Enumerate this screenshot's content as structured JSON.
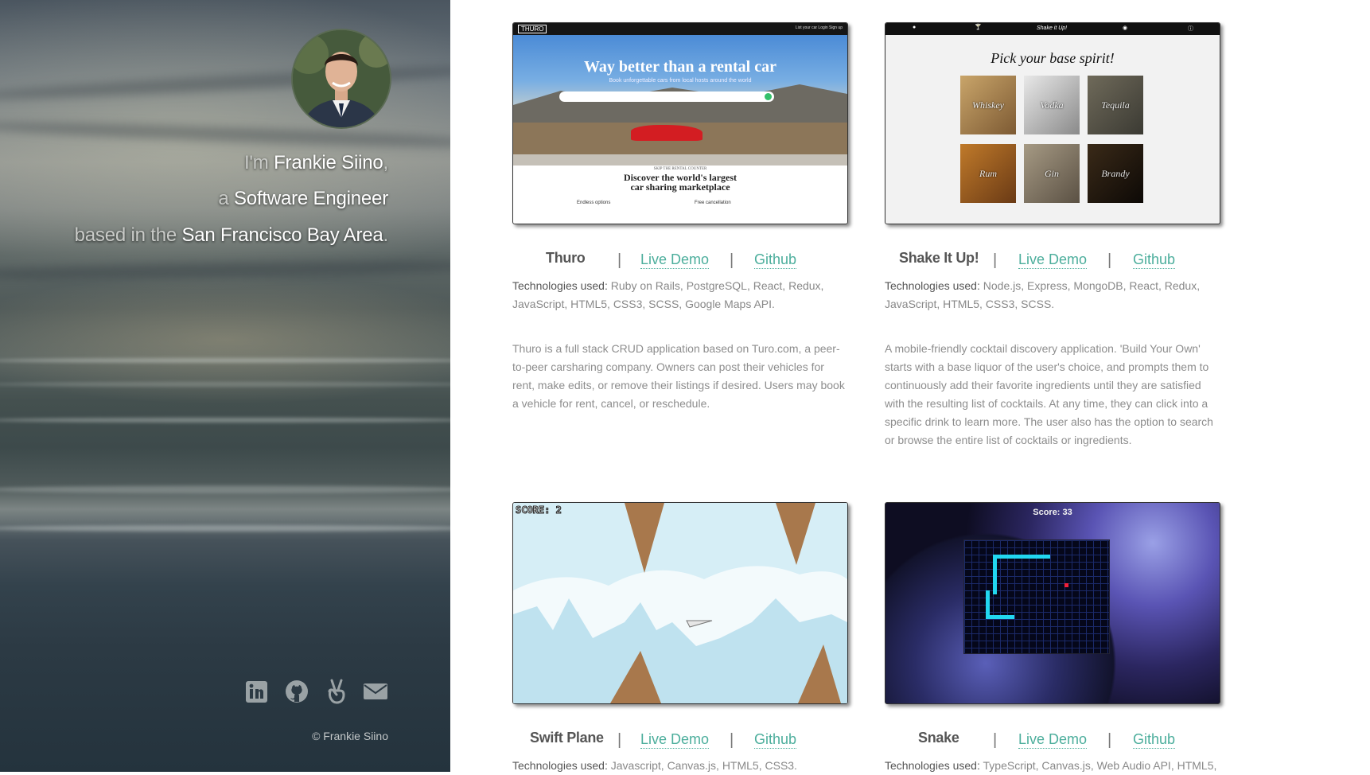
{
  "sidebar": {
    "intro": {
      "line1_prefix": "I'm ",
      "line1_name": "Frankie Siino",
      "line1_suffix": ",",
      "line2_prefix": "a ",
      "line2_role": "Software Engineer",
      "line3_prefix": "based in the ",
      "line3_place": "San Francisco Bay Area",
      "line3_suffix": "."
    },
    "social": [
      {
        "name": "linkedin-icon"
      },
      {
        "name": "github-icon"
      },
      {
        "name": "angellist-icon"
      },
      {
        "name": "email-icon"
      }
    ],
    "copyright": "© Frankie Siino"
  },
  "projects": [
    {
      "title": "Thuro",
      "live_label": "Live Demo",
      "github_label": "Github",
      "tech_label": "Technologies used:",
      "tech": "Ruby on Rails, PostgreSQL, React, Redux, JavaScript, HTML5, CSS3, SCSS, Google Maps API.",
      "description": "Thuro is a full stack CRUD application based on Turo.com, a peer-to-peer carsharing company. Owners can post their vehicles for rent, make edits, or remove their listings if desired. Users may book a vehicle for rent, cancel, or reschedule.",
      "screenshot": {
        "logo": "THURO",
        "nav": "List your car    Login    Sign up",
        "headline": "Way better than a rental car",
        "subhead": "Book unforgettable cars from local hosts around the world",
        "kicker": "SKIP THE RENTAL COUNTER",
        "tagline_1": "Discover the world's largest",
        "tagline_2": "car sharing marketplace",
        "feature_1": "Endless options",
        "feature_2": "Free cancellation"
      }
    },
    {
      "title": "Shake It Up!",
      "live_label": "Live Demo",
      "github_label": "Github",
      "tech_label": "Technologies used:",
      "tech": "Node.js, Express, MongoDB, React, Redux, JavaScript, HTML5, CSS3, SCSS.",
      "description": "A mobile-friendly cocktail discovery application. 'Build Your Own' starts with a base liquor of the user's choice, and prompts them to continuously add their favorite ingredients until they are satisfied with the resulting list of cocktails. At any time, they can click into a specific drink to learn more. The user also has the option to search or browse the entire list of cocktails or ingredients.",
      "screenshot": {
        "nav_title": "Shake it Up!",
        "heading": "Pick your base spirit!",
        "spirits": [
          "Whiskey",
          "Vodka",
          "Tequila",
          "Rum",
          "Gin",
          "Brandy"
        ]
      }
    },
    {
      "title": "Swift Plane",
      "live_label": "Live Demo",
      "github_label": "Github",
      "tech_label": "Technologies used:",
      "tech": "Javascript, Canvas.js, HTML5, CSS3.",
      "screenshot": {
        "score": "SCORE: 2"
      }
    },
    {
      "title": "Snake",
      "live_label": "Live Demo",
      "github_label": "Github",
      "tech_label": "Technologies used:",
      "tech": "TypeScript, Canvas.js, Web Audio API, HTML5,",
      "screenshot": {
        "score": "Score: 33"
      }
    }
  ],
  "colors": {
    "link": "#4cae9c",
    "panel": "#2c3a44"
  }
}
